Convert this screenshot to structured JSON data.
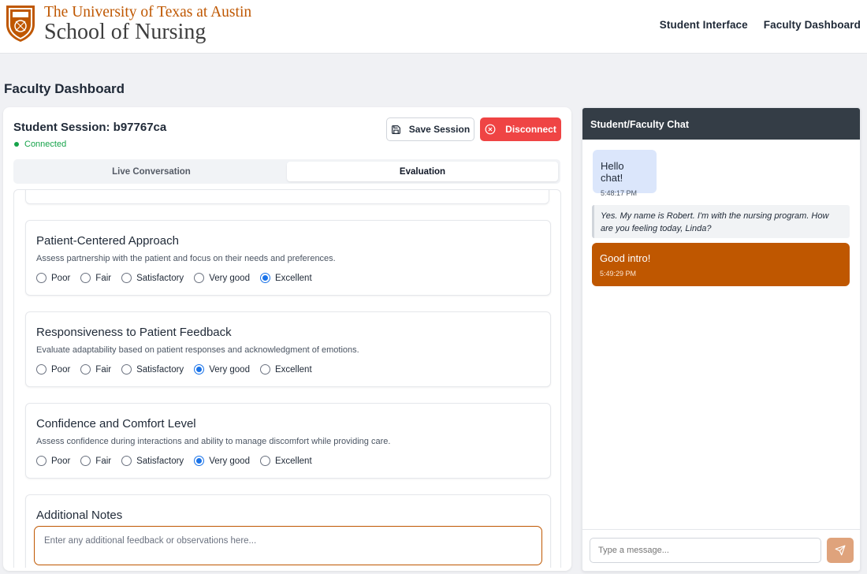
{
  "header": {
    "university": "The University of Texas at Austin",
    "school": "School of Nursing",
    "nav": [
      "Student Interface",
      "Faculty Dashboard"
    ]
  },
  "page_title": "Faculty Dashboard",
  "session": {
    "title": "Student Session: b97767ca",
    "status": "Connected",
    "save_label": "Save Session",
    "disconnect_label": "Disconnect",
    "tabs": [
      "Live Conversation",
      "Evaluation"
    ],
    "active_tab": "Evaluation"
  },
  "evaluation": {
    "options": [
      "Poor",
      "Fair",
      "Satisfactory",
      "Very good",
      "Excellent"
    ],
    "criteria": [
      {
        "title": "Patient-Centered Approach",
        "description": "Assess partnership with the patient and focus on their needs and preferences.",
        "selected": "Excellent"
      },
      {
        "title": "Responsiveness to Patient Feedback",
        "description": "Evaluate adaptability based on patient responses and acknowledgment of emotions.",
        "selected": "Very good"
      },
      {
        "title": "Confidence and Comfort Level",
        "description": "Assess confidence during interactions and ability to manage discomfort while providing care.",
        "selected": "Very good"
      }
    ],
    "notes_title": "Additional Notes",
    "notes_placeholder": "Enter any additional feedback or observations here..."
  },
  "chat": {
    "title": "Student/Faculty Chat",
    "messages": [
      {
        "text": "Hello chat!",
        "time": "5:48:17 PM"
      },
      {
        "text": "Yes. My name is Robert. I'm with the nursing program. How are you feeling today, Linda?"
      },
      {
        "text": "Good intro!",
        "time": "5:49:29 PM"
      }
    ],
    "input_placeholder": "Type a message..."
  },
  "colors": {
    "brand_orange": "#bf5700",
    "disconnect_red": "#ef4444",
    "connected_green": "#16a34a",
    "chat_header": "#343d46"
  }
}
